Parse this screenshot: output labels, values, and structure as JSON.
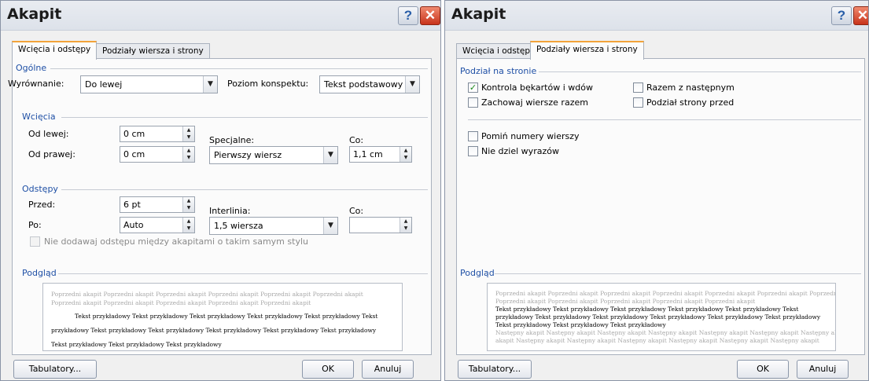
{
  "left": {
    "title": "Akapit",
    "tabs": [
      "Wcięcia i odstępy",
      "Podziały wiersza i strony"
    ],
    "general": {
      "heading": "Ogólne",
      "alignment_label": "Wyrównanie:",
      "alignment_value": "Do lewej",
      "outline_label": "Poziom konspektu:",
      "outline_value": "Tekst podstawowy"
    },
    "indents": {
      "heading": "Wcięcia",
      "left_label": "Od lewej:",
      "left_value": "0 cm",
      "right_label": "Od prawej:",
      "right_value": "0 cm",
      "special_label": "Specjalne:",
      "special_value": "Pierwszy wiersz",
      "by_label": "Co:",
      "by_value": "1,1 cm"
    },
    "spacing": {
      "heading": "Odstępy",
      "before_label": "Przed:",
      "before_value": "6 pt",
      "after_label": "Po:",
      "after_value": "Auto",
      "line_label": "Interlinia:",
      "line_value": "1,5 wiersza",
      "at_label": "Co:",
      "at_value": "",
      "no_space_label": "Nie dodawaj odstępu między akapitami o takim samym stylu",
      "no_space_checked": false
    },
    "preview": {
      "heading": "Podgląd",
      "lines": [
        "Poprzedni akapit Poprzedni akapit Poprzedni akapit Poprzedni akapit Poprzedni akapit Poprzedni akapit",
        "Poprzedni akapit Poprzedni akapit Poprzedni akapit Poprzedni akapit Poprzedni akapit",
        "Tekst przykładowy Tekst przykładowy Tekst przykładowy Tekst przykładowy Tekst przykładowy Tekst",
        "przykładowy Tekst przykładowy Tekst przykładowy Tekst przykładowy Tekst przykładowy Tekst przykładowy",
        "Tekst przykładowy Tekst przykładowy Tekst przykładowy"
      ]
    },
    "buttons": {
      "tabs": "Tabulatory...",
      "ok": "OK",
      "cancel": "Anuluj"
    }
  },
  "right": {
    "title": "Akapit",
    "tabs": [
      "Wcięcia i odstępy",
      "Podziały wiersza i strony"
    ],
    "pagination": {
      "heading": "Podział na stronie",
      "widow_label": "Kontrola bękartów i wdów",
      "widow_checked": true,
      "keep_lines_label": "Zachowaj wiersze razem",
      "keep_lines_checked": false,
      "keep_next_label": "Razem z następnym",
      "keep_next_checked": false,
      "page_break_label": "Podział strony przed",
      "page_break_checked": false
    },
    "formatting": {
      "suppress_numbers_label": "Pomiń numery wierszy",
      "suppress_numbers_checked": false,
      "no_hyphen_label": "Nie dziel wyrazów",
      "no_hyphen_checked": false
    },
    "preview": {
      "heading": "Podgląd",
      "lines": [
        "Poprzedni akapit Poprzedni akapit Poprzedni akapit Poprzedni akapit Poprzedni akapit Poprzedni akapit Poprzedni akapit",
        "Poprzedni akapit Poprzedni akapit Poprzedni akapit Poprzedni akapit Poprzedni akapit",
        "Tekst przykładowy Tekst przykładowy Tekst przykładowy Tekst przykładowy Tekst przykładowy Tekst",
        "przykładowy Tekst przykładowy Tekst przykładowy Tekst przykładowy Tekst przykładowy Tekst przykładowy",
        "Tekst przykładowy Tekst przykładowy Tekst przykładowy",
        "Następny akapit Następny akapit Następny akapit Następny akapit Następny akapit Następny akapit Następny akapit",
        "akapit Następny akapit Następny akapit Następny akapit Następny akapit Następny akapit Następny akapit"
      ]
    },
    "buttons": {
      "tabs": "Tabulatory...",
      "ok": "OK",
      "cancel": "Anuluj"
    }
  }
}
